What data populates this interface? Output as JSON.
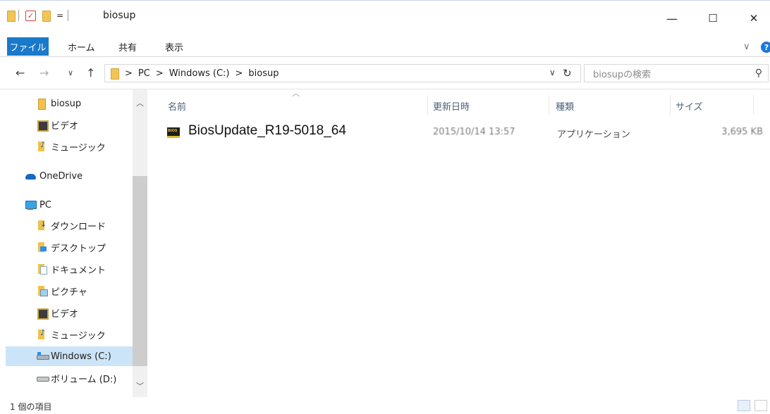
{
  "window": {
    "title": "biosup",
    "quick_access_menu": "=",
    "minimize": "—",
    "maximize": "☐",
    "close": "✕"
  },
  "ribbon": {
    "tabs": [
      "ファイル",
      "ホーム",
      "共有",
      "表示"
    ],
    "expand": "∨",
    "help": "?"
  },
  "navigation": {
    "back": "←",
    "forward": "→",
    "recent": "∨",
    "up": "↑",
    "breadcrumb": [
      "PC",
      "Windows (C:)",
      "biosup"
    ],
    "separator": ">",
    "dropdown": "∨",
    "refresh": "↻"
  },
  "search": {
    "placeholder": "biosupの検索"
  },
  "sidebar": {
    "items": [
      {
        "label": "biosup",
        "icon": "folder-icon"
      },
      {
        "label": "ビデオ",
        "icon": "video-icon"
      },
      {
        "label": "ミュージック",
        "icon": "music-icon"
      },
      {
        "label": "OneDrive",
        "icon": "cloud-icon"
      },
      {
        "label": "PC",
        "icon": "pc-icon"
      },
      {
        "label": "ダウンロード",
        "icon": "download-icon"
      },
      {
        "label": "デスクトップ",
        "icon": "desktop-icon"
      },
      {
        "label": "ドキュメント",
        "icon": "documents-icon"
      },
      {
        "label": "ピクチャ",
        "icon": "pictures-icon"
      },
      {
        "label": "ビデオ",
        "icon": "video-icon"
      },
      {
        "label": "ミュージック",
        "icon": "music-icon"
      },
      {
        "label": "Windows (C:)",
        "icon": "drive-icon"
      },
      {
        "label": "ボリューム (D:)",
        "icon": "drive-icon"
      }
    ]
  },
  "file_list": {
    "columns": [
      "名前",
      "更新日時",
      "種類",
      "サイズ"
    ],
    "rows": [
      {
        "name": "BiosUpdate_R19-5018_64",
        "modified": "2015/10/14 13:57",
        "type": "アプリケーション",
        "size": "3,695 KB",
        "icon": "bios-exe-icon"
      }
    ]
  },
  "status": {
    "item_count": "1 個の項目"
  }
}
